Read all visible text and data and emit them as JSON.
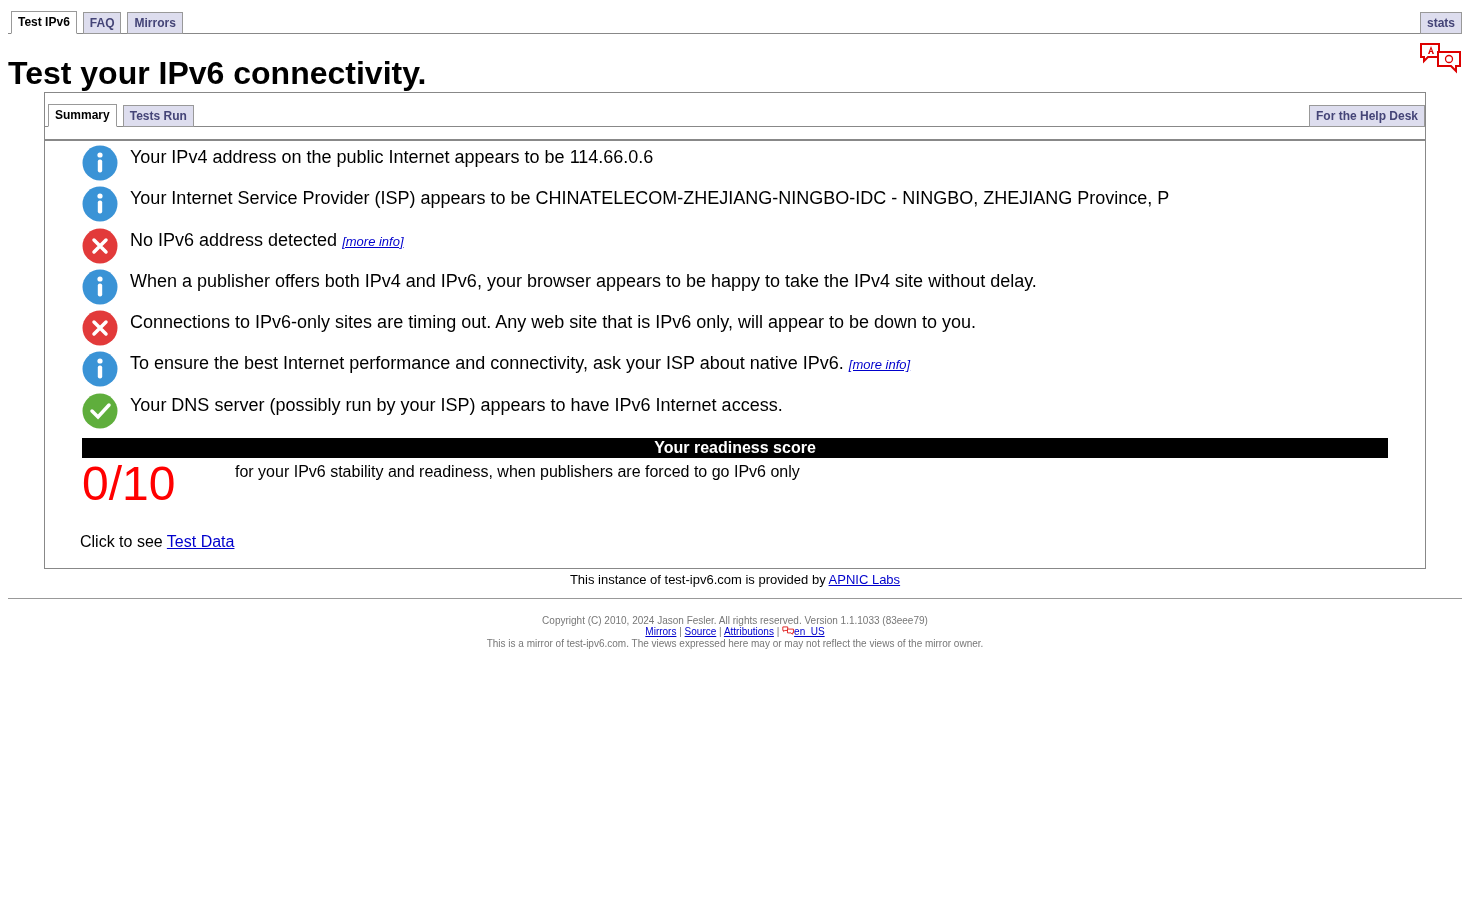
{
  "top_tabs": [
    {
      "label": "Test IPv6",
      "selected": true
    },
    {
      "label": "FAQ",
      "selected": false
    },
    {
      "label": "Mirrors",
      "selected": false
    }
  ],
  "top_right_tab": {
    "label": "stats",
    "selected": false
  },
  "title": "Test your IPv6 connectivity.",
  "inner_tabs": [
    {
      "label": "Summary",
      "selected": true
    },
    {
      "label": "Tests Run",
      "selected": false
    }
  ],
  "inner_right_tab": {
    "label": "For the Help Desk",
    "selected": false
  },
  "results": [
    {
      "kind": "info",
      "text": "Your IPv4 address on the public Internet appears to be 114.66.0.6"
    },
    {
      "kind": "info",
      "text": "Your Internet Service Provider (ISP) appears to be CHINATELECOM-ZHEJIANG-NINGBO-IDC - NINGBO, ZHEJIANG Province, P"
    },
    {
      "kind": "error",
      "text": "No IPv6 address detected",
      "link": "[more info]"
    },
    {
      "kind": "info",
      "text": "When a publisher offers both IPv4 and IPv6, your browser appears to be happy to take the IPv4 site without delay."
    },
    {
      "kind": "error",
      "text": "Connections to IPv6-only sites are timing out. Any web site that is IPv6 only, will appear to be down to you."
    },
    {
      "kind": "info",
      "text": "To ensure the best Internet performance and connectivity, ask your ISP about native IPv6.",
      "link": "[more info]"
    },
    {
      "kind": "ok",
      "text": "Your DNS server (possibly run by your ISP) appears to have IPv6 Internet access."
    }
  ],
  "score": {
    "heading": "Your readiness score",
    "value": "0/10",
    "description": "for your IPv6 stability and readiness, when publishers are forced to go IPv6 only"
  },
  "test_data": {
    "text": "Click to see",
    "link": "Test Data"
  },
  "provider": {
    "text": "This instance of test-ipv6.com is provided by",
    "link": "APNIC Labs"
  },
  "footer": {
    "copyright": "Copyright (C) 2010, 2024 Jason Fesler. All rights reserved. Version 1.1.1033 (83eee79)",
    "links": [
      "Mirrors",
      "Source",
      "Attributions"
    ],
    "separator": "|",
    "locale": "en_US",
    "mirror_note": "This is a mirror of test-ipv6.com. The views expressed here may or may not reflect the views of the mirror owner."
  }
}
